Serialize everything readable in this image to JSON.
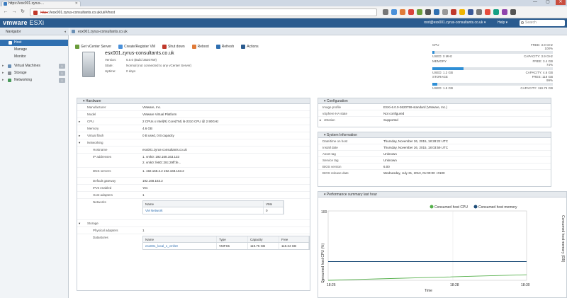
{
  "browser": {
    "tab_title": "https://esx001.zyrus-...",
    "url_prefix": "https",
    "url_rest": "://esx001.zyrus-consultants.co.uk/ui/#/host",
    "controls": [
      "—",
      "▢",
      "✕"
    ]
  },
  "header": {
    "brand_vm": "vm",
    "brand_ware": "ware",
    "brand_product": " ESXi",
    "user": "root@esx001.zyrus-consultants.co.uk ▾",
    "help": "Help ▾",
    "search_placeholder": "Search"
  },
  "navigator": {
    "title": "Navigator",
    "items": [
      {
        "label": "Host",
        "selected": true
      },
      {
        "label": "Manage"
      },
      {
        "label": "Monitor"
      },
      {
        "label": "Virtual Machines",
        "badge": "1"
      },
      {
        "label": "Storage",
        "badge": "1"
      },
      {
        "label": "Networking",
        "badge": "1"
      }
    ]
  },
  "main": {
    "breadcrumb": "esx001.zyrus-consultants.co.uk",
    "toolbar": [
      "Get vCenter Server",
      "Create/Register VM",
      "Shut down",
      "Reboot",
      "Refresh",
      "Actions"
    ],
    "host_name": "esx001.zyrus-consultants.co.uk",
    "host_details": [
      {
        "k": "Version:",
        "v": "6.0.0 (Build 3620759)"
      },
      {
        "k": "State:",
        "v": "Normal (not connected to any vCenter Server)"
      },
      {
        "k": "Uptime:",
        "v": "0 days"
      }
    ]
  },
  "resources": [
    {
      "name": "CPU",
      "free": "FREE: 3.9 GHz",
      "used": "USED: 0 MHz",
      "capacity": "CAPACITY: 3.9 GHz",
      "pct_label": "100%",
      "used_fraction": 0.02
    },
    {
      "name": "MEMORY",
      "free": "FREE: 3.4 GB",
      "used": "USED: 1.2 GB",
      "capacity": "CAPACITY: 4.6 GB",
      "pct_label": "74%",
      "used_fraction": 0.26
    },
    {
      "name": "STORAGE",
      "free": "FREE: 118 GB",
      "used": "USED: 1.5 GB",
      "capacity": "CAPACITY: 119.75 GB",
      "pct_label": "99%",
      "used_fraction": 0.04
    }
  ],
  "hardware": {
    "title": "Hardware",
    "rows": [
      {
        "k": "Manufacturer",
        "v": "VMware, Inc."
      },
      {
        "k": "Model",
        "v": "VMware Virtual Platform"
      },
      {
        "k": "CPU",
        "v": "2 CPUs x Intel(R) Core(TM) i5-2310 CPU @ 2.90GHz"
      },
      {
        "k": "Memory",
        "v": "4.6 GB"
      },
      {
        "k": "Virtual flash",
        "v": "0 B used, 0 B capacity"
      },
      {
        "k": "Networking",
        "v": ""
      },
      {
        "k": "Hostname",
        "v": "esx001.zyrus-consultants.co.uk"
      },
      {
        "k": "IP addresses",
        "v": "1. vmk0: 192.168.163.133"
      },
      {
        "k": "",
        "v": "2. vmk0: fe80::20c:29ff:fe..."
      },
      {
        "k": "DNS servers",
        "v": "1. 192.168.2.2 192.168.163.2"
      },
      {
        "k": "Default gateway",
        "v": "192.168.163.2"
      },
      {
        "k": "IPv6 enabled",
        "v": "Yes"
      },
      {
        "k": "Host adapters",
        "v": "1"
      },
      {
        "k": "Networks",
        "v": ""
      },
      {
        "k": "Storage",
        "v": ""
      },
      {
        "k": "Physical adapters",
        "v": "1"
      },
      {
        "k": "Datastores",
        "v": ""
      }
    ],
    "networks_table": {
      "headers": [
        "Name",
        "VMs"
      ],
      "rows": [
        [
          "VM Network",
          "0"
        ]
      ]
    },
    "datastores_table": {
      "headers": [
        "Name",
        "Type",
        "Capacity",
        "Free"
      ],
      "rows": [
        [
          "esx001_local_1_vmfs0",
          "VMFS5",
          "119.75 GB",
          "118.34 GB"
        ]
      ]
    }
  },
  "configuration": {
    "title": "Configuration",
    "rows": [
      {
        "k": "Image profile",
        "v": "ESXi-6.0.0-3620759-standard (VMware, Inc.)"
      },
      {
        "k": "vSphere HA state",
        "v": "Not configured"
      },
      {
        "k": "vMotion",
        "v": "Supported"
      }
    ]
  },
  "system_info": {
    "title": "System Information",
    "rows": [
      {
        "k": "Date/time on host",
        "v": "Thursday, November 26, 2015, 18:28:22 UTC"
      },
      {
        "k": "Install date",
        "v": "Thursday, November 26, 2015, 18:03:59 UTC"
      },
      {
        "k": "Asset tag",
        "v": "Unknown"
      },
      {
        "k": "Service tag",
        "v": "Unknown"
      },
      {
        "k": "BIOS version",
        "v": "6.00"
      },
      {
        "k": "BIOS release date",
        "v": "Wednesday, July 31, 2013, 01:00:00 +0100"
      }
    ]
  },
  "perf_chart": {
    "title": "Performance summary last hour",
    "legend": [
      "Consumed host CPU",
      "Consumed host memory"
    ],
    "ylabel_left": "Consumed host CPU (%)",
    "ylabel_right": "Consumed host memory (GB)",
    "xlabel": "Time"
  },
  "chart_data": {
    "type": "line",
    "title": "Performance summary last hour",
    "xlabel": "Time",
    "ylabel": "Consumed host CPU (%)",
    "y2label": "Consumed host memory (GB)",
    "x_ticks": [
      "18:26",
      "18:28",
      "18:30"
    ],
    "y_ticks": [
      "100",
      "0"
    ],
    "ylim": [
      0,
      100
    ],
    "series": [
      {
        "name": "Consumed host CPU",
        "color": "#55b04b",
        "values": [
          0,
          2,
          4,
          6,
          8
        ]
      },
      {
        "name": "Consumed host memory",
        "color": "#1f4e79",
        "values": [
          27,
          27,
          27,
          27,
          27
        ]
      }
    ]
  },
  "colors": {
    "brand": "#2a5b8f",
    "selected": "#2f6fb0",
    "cpu_line": "#55b04b",
    "mem_line": "#1f4e79"
  }
}
